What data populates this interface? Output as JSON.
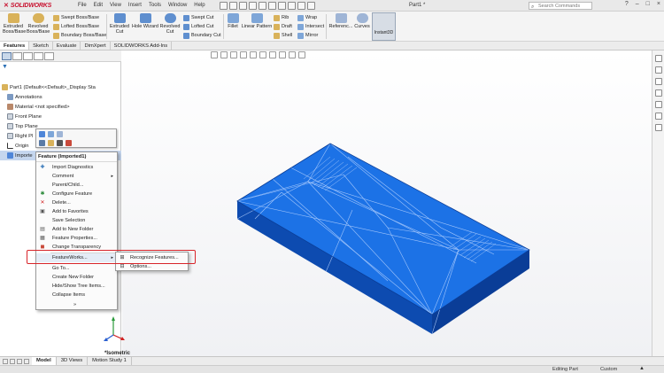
{
  "app": {
    "brand": "SOLIDWORKS",
    "doc_title": "Part1 *",
    "search_placeholder": "Search Commands"
  },
  "menu": [
    "File",
    "Edit",
    "View",
    "Insert",
    "Tools",
    "Window",
    "Help"
  ],
  "window_controls": [
    "?",
    "–",
    "□",
    "×"
  ],
  "ribbon": {
    "extruded_boss": "Extruded Boss/Base",
    "revolved_boss": "Revolved Boss/Base",
    "swept_boss": "Swept Boss/Base",
    "lofted_boss": "Lofted Boss/Base",
    "boundary_boss": "Boundary Boss/Base",
    "extruded_cut": "Extruded Cut",
    "hole_wizard": "Hole Wizard",
    "revolved_cut": "Revolved Cut",
    "swept_cut": "Swept Cut",
    "lofted_cut": "Lofted Cut",
    "boundary_cut": "Boundary Cut",
    "fillet": "Fillet",
    "linear_pattern": "Linear Pattern",
    "rib": "Rib",
    "draft": "Draft",
    "shell": "Shell",
    "wrap": "Wrap",
    "intersect": "Intersect",
    "mirror": "Mirror",
    "reference": "Referenc...",
    "curves": "Curves",
    "instant3d": "Instant3D"
  },
  "command_tabs": [
    "Features",
    "Sketch",
    "Evaluate",
    "DimXpert",
    "SOLIDWORKS Add-Ins"
  ],
  "tree": {
    "root": "Part1  (Default<<Default>_Display Sta",
    "items": [
      "Annotations",
      "Material <not specified>",
      "Front Plane",
      "Top Plane",
      "Right Pl",
      "Origin",
      "Importe"
    ]
  },
  "context_menu": {
    "header": "Feature (Imported1)",
    "items": [
      "Import Diagnostics",
      "Comment",
      "Parent/Child...",
      "Configure Feature",
      "Delete...",
      "Add to Favorites",
      "Save Selection",
      "Add to New Folder",
      "Feature Properties...",
      "Change Transparency"
    ],
    "featureworks": "FeatureWorks...",
    "items2": [
      "Go To...",
      "Create New Folder",
      "Hide/Show Tree Items...",
      "Collapse Items"
    ],
    "more": "»"
  },
  "submenu": {
    "items": [
      "Recognize Features...",
      "Options..."
    ]
  },
  "view_label": "*Isometric",
  "bottom_tabs": [
    "Model",
    "3D Views",
    "Motion Study 1"
  ],
  "status": {
    "mode": "Editing Part",
    "units": "Custom",
    "arrow": "▲"
  },
  "colors": {
    "part_blue": "#1a6fe0",
    "part_edge": "#0b3f9a",
    "highlight_red": "#d8252a",
    "brand_red": "#c8102e"
  }
}
